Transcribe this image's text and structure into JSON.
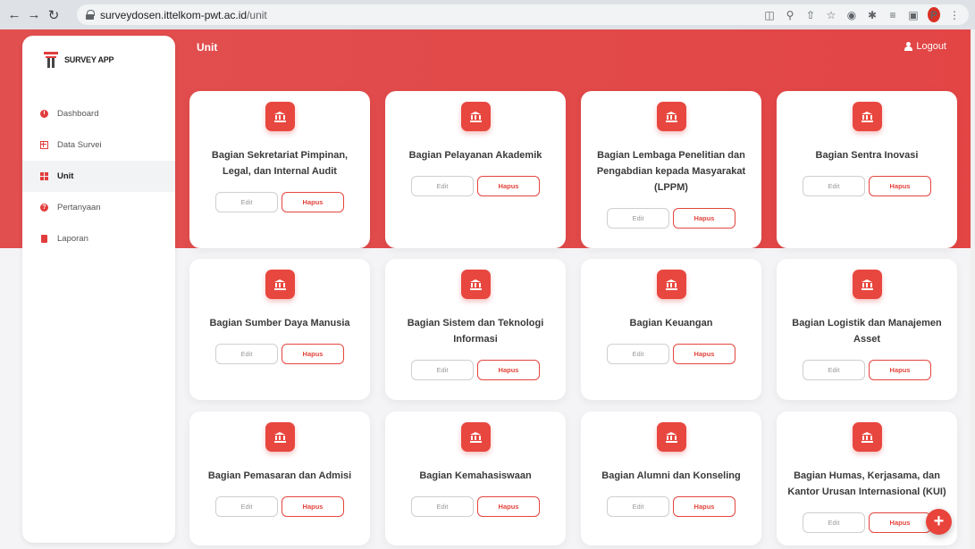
{
  "browser": {
    "url_host": "surveydosen.ittelkom-pwt.ac.id",
    "url_path": "/unit",
    "profile_initial": "P"
  },
  "brand": {
    "name": "SURVEY APP",
    "accent": "#e23d3d"
  },
  "header": {
    "title": "Unit",
    "logout_label": "Logout"
  },
  "sidebar": {
    "items": [
      {
        "label": "Dashboard",
        "icon": "dashboard-icon",
        "active": false
      },
      {
        "label": "Data Survei",
        "icon": "table-icon",
        "active": false
      },
      {
        "label": "Unit",
        "icon": "grid-icon",
        "active": true
      },
      {
        "label": "Pertanyaan",
        "icon": "question-icon",
        "active": false
      },
      {
        "label": "Laporan",
        "icon": "file-icon",
        "active": false
      }
    ]
  },
  "actions": {
    "edit_label": "Edit",
    "delete_label": "Hapus",
    "add_icon": "plus-icon"
  },
  "units": [
    {
      "name": "Bagian Sekretariat Pimpinan, Legal, dan Internal Audit"
    },
    {
      "name": "Bagian Pelayanan Akademik"
    },
    {
      "name": "Bagian Lembaga Penelitian dan Pengabdian kepada Masyarakat (LPPM)"
    },
    {
      "name": "Bagian Sentra Inovasi"
    },
    {
      "name": "Bagian Sumber Daya Manusia"
    },
    {
      "name": "Bagian Sistem dan Teknologi Informasi"
    },
    {
      "name": "Bagian Keuangan"
    },
    {
      "name": "Bagian Logistik dan Manajemen Asset"
    },
    {
      "name": "Bagian Pemasaran dan Admisi"
    },
    {
      "name": "Bagian Kemahasiswaan"
    },
    {
      "name": "Bagian Alumni dan Konseling"
    },
    {
      "name": "Bagian Humas, Kerjasama, dan Kantor Urusan Internasional (KUI)"
    }
  ]
}
